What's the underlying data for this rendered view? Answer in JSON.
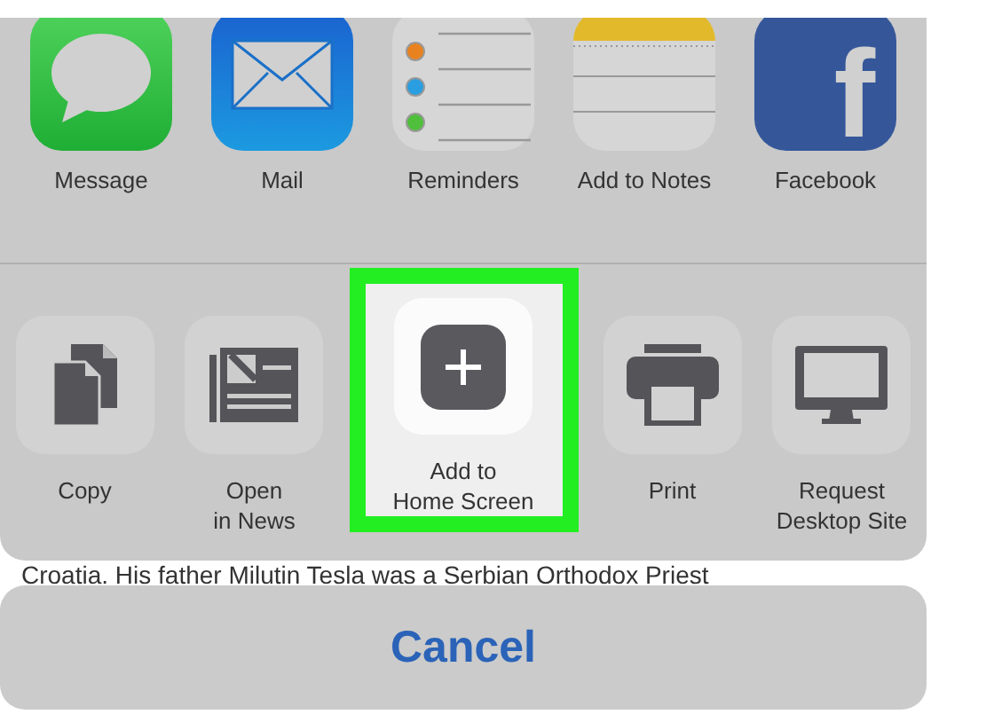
{
  "app_row": [
    {
      "label": "Message",
      "kind": "message"
    },
    {
      "label": "Mail",
      "kind": "mail"
    },
    {
      "label": "Reminders",
      "kind": "reminders"
    },
    {
      "label": "Add to Notes",
      "kind": "notes"
    },
    {
      "label": "Facebook",
      "kind": "facebook",
      "glyph": "f"
    }
  ],
  "action_row": [
    {
      "label": "Copy",
      "kind": "copy",
      "selected": false
    },
    {
      "label": "Open\nin News",
      "kind": "news",
      "selected": false
    },
    {
      "label": "Add to\nHome Screen",
      "kind": "add-home",
      "selected": true
    },
    {
      "label": "Print",
      "kind": "print",
      "selected": false
    },
    {
      "label": "Request\nDesktop Site",
      "kind": "desktop",
      "selected": false
    }
  ],
  "background_text": "Croatia. His father Milutin Tesla was a Serbian Orthodox Priest",
  "cancel_button": "Cancel"
}
